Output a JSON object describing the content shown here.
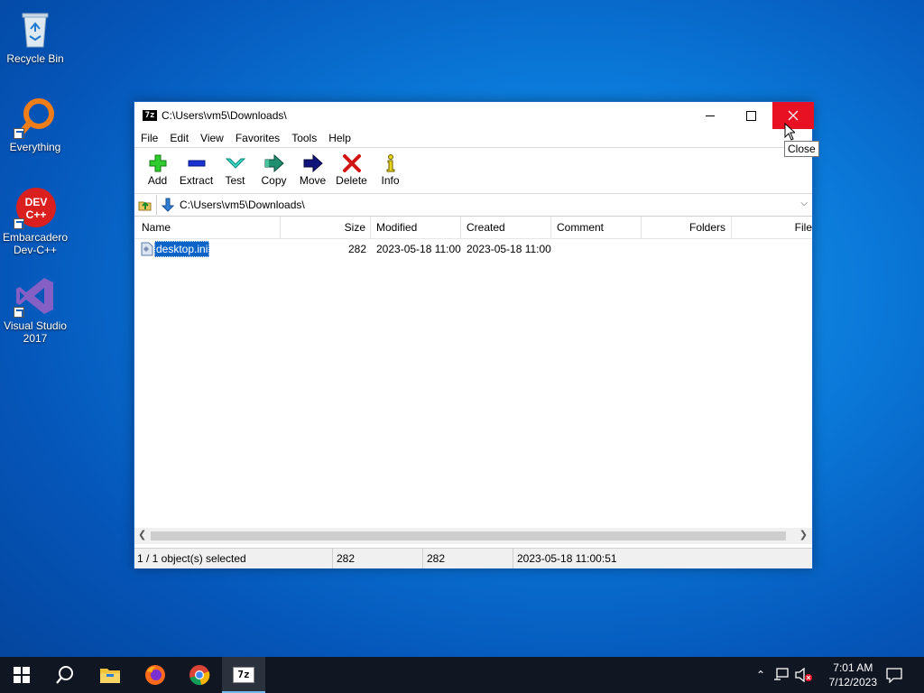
{
  "desktop": {
    "icons": [
      {
        "label": "Recycle Bin"
      },
      {
        "label": "Everything"
      },
      {
        "label": "Embarcadero Dev-C++"
      },
      {
        "label": "Visual Studio 2017"
      }
    ]
  },
  "window": {
    "logo": "7z",
    "title": "C:\\Users\\vm5\\Downloads\\",
    "menu": [
      "File",
      "Edit",
      "View",
      "Favorites",
      "Tools",
      "Help"
    ],
    "toolbar": [
      "Add",
      "Extract",
      "Test",
      "Copy",
      "Move",
      "Delete",
      "Info"
    ],
    "address": "C:\\Users\\vm5\\Downloads\\",
    "columns": [
      "Name",
      "Size",
      "Modified",
      "Created",
      "Comment",
      "Folders",
      "File"
    ],
    "files": [
      {
        "name": "desktop.ini",
        "size": "282",
        "modified": "2023-05-18 11:00",
        "created": "2023-05-18 11:00"
      }
    ],
    "status": {
      "selected": "1 / 1 object(s) selected",
      "size": "282",
      "packed": "282",
      "date": "2023-05-18 11:00:51"
    },
    "tooltip": "Close"
  },
  "taskbar": {
    "time": "7:01 AM",
    "date": "7/12/2023",
    "active_logo": "7z"
  },
  "colors": {
    "close_red": "#e81123",
    "selection": "#0a64c8",
    "taskbar": "#101622"
  }
}
